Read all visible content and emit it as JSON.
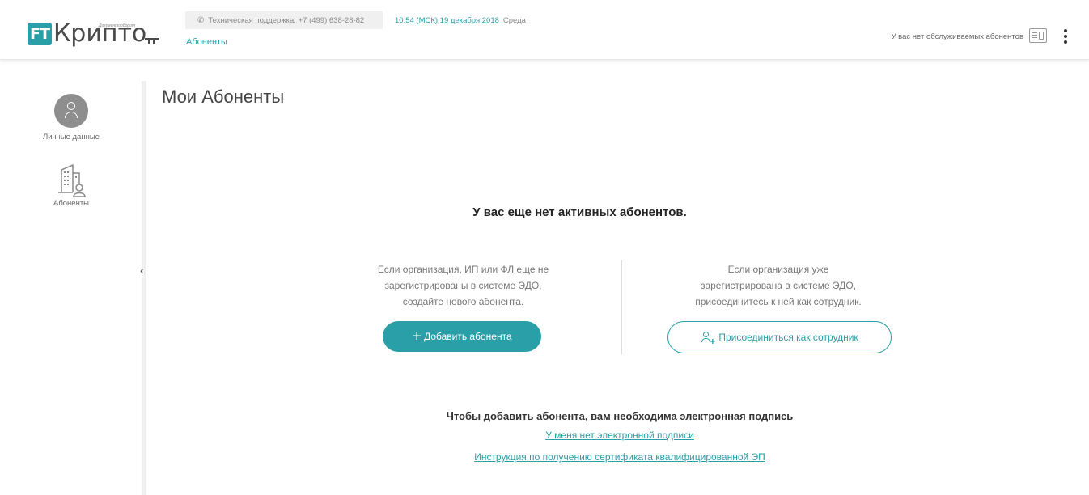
{
  "header": {
    "logo_badge": "FT",
    "logo_text": "Крипто",
    "logo_sub": "Документооборот",
    "support_text": "Техническая поддержка: +7 (499) 638-28-82",
    "datetime": "10:54 (МСК) 19 декабря 2018",
    "weekday": "Среда",
    "breadcrumb": "Абоненты",
    "no_subscribers_text": "У вас нет обслуживаемых абонентов"
  },
  "sidebar": {
    "items": [
      {
        "label": "Личные данные",
        "icon": "user-avatar-icon"
      },
      {
        "label": "Абоненты",
        "icon": "building-user-icon"
      }
    ]
  },
  "main": {
    "page_title": "Мои Абоненты",
    "empty_title": "У вас еще нет активных абонентов.",
    "left_column": {
      "lines": [
        "Если организация, ИП или ФЛ еще не",
        "зарегистрированы в системе ЭДО,",
        "создайте нового абонента."
      ],
      "button_label": "Добавить абонента"
    },
    "right_column": {
      "lines": [
        "Если организация уже",
        "зарегистрирована в системе ЭДО,",
        "присоединитесь к ней как сотрудник."
      ],
      "button_label": "Присоединиться как сотрудник"
    },
    "signature_title": "Чтобы добавить абонента, вам необходима электронная подпись",
    "link_no_signature": "У меня нет электронной подписи",
    "link_instruction": "Инструкция по получению сертификата квалифицированной ЭП"
  },
  "colors": {
    "accent": "#2a9fa7",
    "text_muted": "#777777"
  }
}
